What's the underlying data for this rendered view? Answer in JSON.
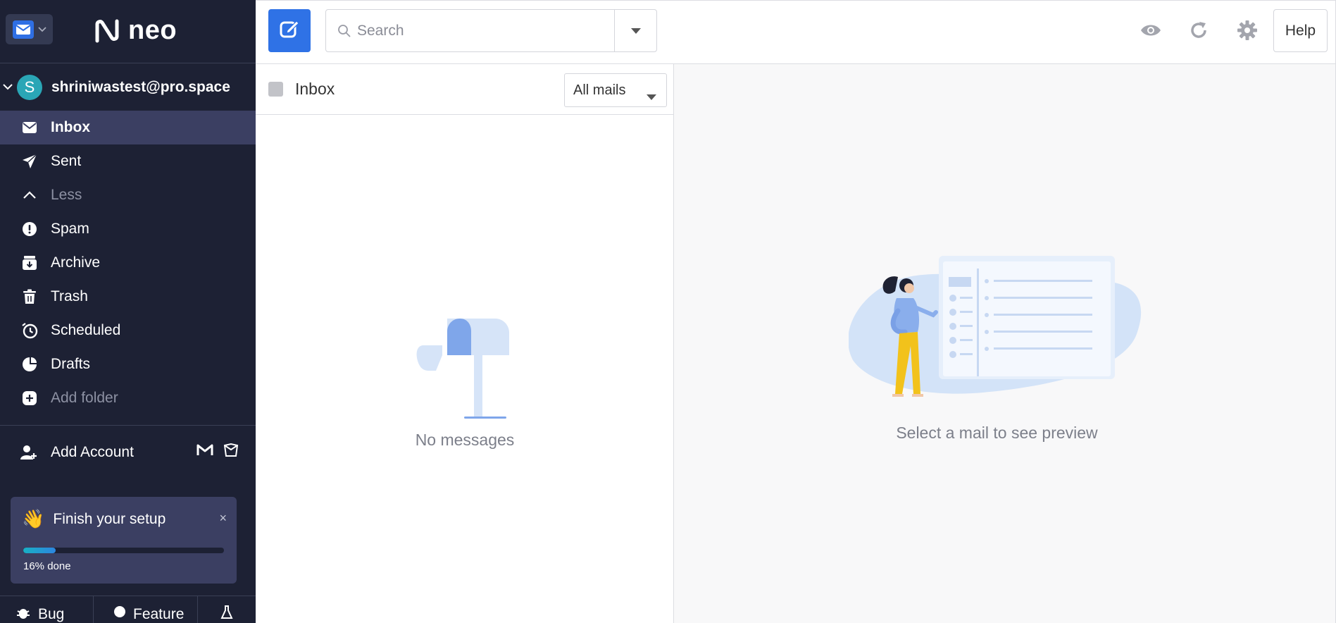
{
  "app": {
    "brand": "neo"
  },
  "account": {
    "avatar_letter": "S",
    "email": "shriniwastest@pro.space"
  },
  "folders": [
    {
      "label": "Inbox",
      "icon": "envelope-icon",
      "active": true
    },
    {
      "label": "Sent",
      "icon": "paper-plane-icon"
    },
    {
      "label": "Less",
      "icon": "chevron-up-icon",
      "dim": true
    },
    {
      "label": "Spam",
      "icon": "exclamation-icon"
    },
    {
      "label": "Archive",
      "icon": "archive-icon"
    },
    {
      "label": "Trash",
      "icon": "trash-icon"
    },
    {
      "label": "Scheduled",
      "icon": "clock-icon"
    },
    {
      "label": "Drafts",
      "icon": "draft-icon"
    },
    {
      "label": "Add folder",
      "icon": "plus-icon",
      "dim": true
    }
  ],
  "add_account": {
    "label": "Add Account"
  },
  "setup": {
    "emoji": "👋",
    "title": "Finish your setup",
    "close": "×",
    "progress_label": "16% done",
    "progress": 0.16
  },
  "bottom_buttons": {
    "bug": "Bug",
    "feature": "Feature"
  },
  "toolbar": {
    "search_placeholder": "Search",
    "help_label": "Help"
  },
  "list": {
    "title": "Inbox",
    "filter_value": "All mails",
    "empty_text": "No messages"
  },
  "preview": {
    "empty_text": "Select a mail to see preview"
  },
  "colors": {
    "sidebar_bg": "#1d2134",
    "active_bg": "#3b3f62",
    "accent": "#2f72e6",
    "progress": "#18b0c4"
  }
}
